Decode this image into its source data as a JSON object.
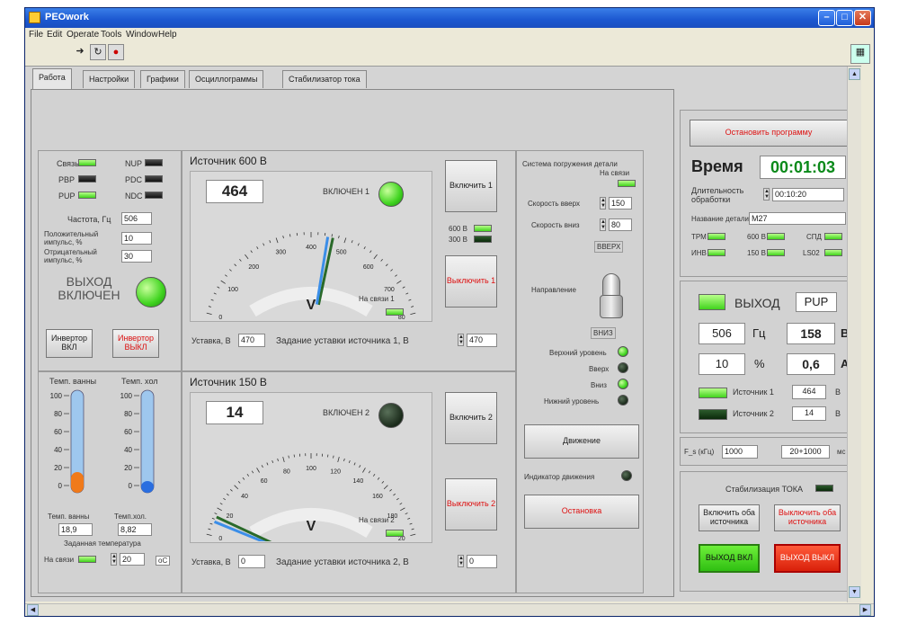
{
  "window": {
    "title": "PEOwork"
  },
  "menu": [
    "File",
    "Edit",
    "Operate",
    "Tools",
    "Window",
    "Help"
  ],
  "tabs": [
    "Работа",
    "Настройки",
    "Графики",
    "Осциллограммы",
    "Стабилизатор тока"
  ],
  "status": {
    "svyaz": "Связь",
    "nup": "NUP",
    "pbp": "PBP",
    "pdc": "PDC",
    "pup": "PUP",
    "ndc": "NDC",
    "freq_label": "Частота, Гц",
    "freq": "506",
    "pos_label": "Положительный импульс, %",
    "pos": "10",
    "neg_label": "Отрицательный импульс, %",
    "neg": "30",
    "vyhod": "ВЫХОД ВКЛЮЧЕН",
    "inv_on": "Инвертор ВКЛ",
    "inv_off": "Инвертор ВЫКЛ"
  },
  "temp": {
    "bath_label": "Темп. ванны",
    "col_label": "Темп. хол",
    "ticks": [
      "100",
      "80",
      "60",
      "40",
      "20",
      "0"
    ],
    "bath_val_label": "Темп. ванны",
    "col_val_label": "Темп.хол.",
    "bath": "18,9",
    "col": "8,82",
    "set_label": "Заданная температура",
    "online": "На связи",
    "set": "20",
    "unit": "оС",
    "bath_level": 15,
    "col_level": 5
  },
  "src1": {
    "title": "Источник 600 В",
    "value": "464",
    "on_label": "ВКЛЮЧЕН 1",
    "ticks": [
      "0",
      "100",
      "200",
      "300",
      "400",
      "500",
      "600",
      "700",
      "80"
    ],
    "unit": "V",
    "online": "На связи 1",
    "btn_on": "Включить 1",
    "btn_off": "Выключить 1",
    "led600": "600 В",
    "led300": "300 В",
    "ust_label": "Уставка, В",
    "ust": "470",
    "zad_label": "Задание уставки источника 1, В",
    "zad": "470"
  },
  "src2": {
    "title": "Источник 150 В",
    "value": "14",
    "on_label": "ВКЛЮЧЕН 2",
    "ticks": [
      "0",
      "20",
      "40",
      "60",
      "80",
      "100",
      "120",
      "140",
      "160",
      "180",
      "20"
    ],
    "unit": "V",
    "online": "На связи 2",
    "btn_on": "Включить 2",
    "btn_off": "Выключить 2",
    "ust_label": "Уставка, В",
    "ust": "0",
    "zad_label": "Задание уставки источника 2, В",
    "zad": "0"
  },
  "drive": {
    "title": "Система погружения детали",
    "online": "На связи",
    "up_speed_label": "Скорость вверх",
    "up_speed": "150",
    "down_speed_label": "Скорость вниз",
    "down_speed": "80",
    "up": "ВВЕРХ",
    "dir_label": "Направление",
    "down": "ВНИЗ",
    "top_level": "Верхний уровень",
    "upw": "Вверх",
    "dnw": "Вниз",
    "low_level": "Нижний уровень",
    "move": "Движение",
    "move_ind": "Индикатор движения",
    "stop": "Остановка"
  },
  "right": {
    "stop_prog": "Остановить программу",
    "time_label": "Время",
    "time": "00:01:03",
    "dur_label": "Длительность обработки",
    "dur": "00:10:20",
    "part_label": "Название детали",
    "part": "M27",
    "leds": [
      "ТРМ",
      "600 В",
      "СПД",
      "ИНВ",
      "150 В",
      "LS02"
    ],
    "out_label": "ВЫХОД",
    "out_mode": "PUP",
    "freq": "506",
    "freq_unit": "Гц",
    "volt": "158",
    "volt_unit": "В",
    "pct": "10",
    "pct_unit": "%",
    "amp": "0,6",
    "amp_unit": "А",
    "src1_label": "Источник 1",
    "src1": "464",
    "src1_unit": "В",
    "src2_label": "Источник 2",
    "src2": "14",
    "src2_unit": "В",
    "fs_label": "F_s (кГц)",
    "fs": "1000",
    "fs2": "20+1000",
    "fs_unit": "мс",
    "stab_label": "Стабилизация ТОКА",
    "on_both": "Включить оба источника",
    "off_both": "Выключить оба источника",
    "out_on": "ВЫХОД ВКЛ",
    "out_off": "ВЫХОД ВЫКЛ"
  }
}
